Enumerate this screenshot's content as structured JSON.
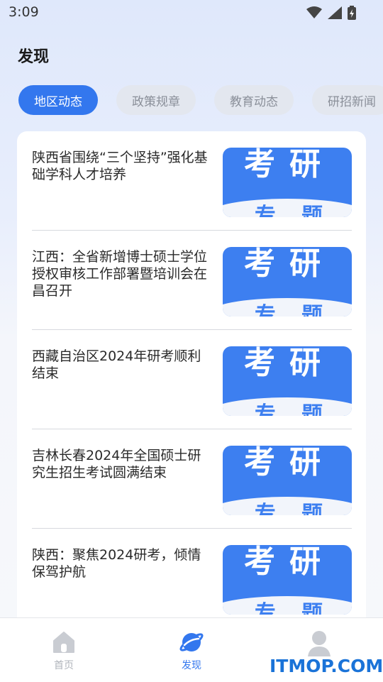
{
  "status_bar": {
    "time": "3:09"
  },
  "header": {
    "title": "发现"
  },
  "tabs": [
    {
      "label": "地区动态",
      "active": true
    },
    {
      "label": "政策规章",
      "active": false
    },
    {
      "label": "教育动态",
      "active": false
    },
    {
      "label": "研招新闻",
      "active": false
    }
  ],
  "news": [
    {
      "title": "陕西省围绕“三个坚持”强化基础学科人才培养",
      "thumb_text": "考研",
      "thumb_sub": "专题"
    },
    {
      "title": "江西：全省新增博士硕士学位授权审核工作部署暨培训会在昌召开",
      "thumb_text": "考研",
      "thumb_sub": "专题"
    },
    {
      "title": "西藏自治区2024年研考顺利结束",
      "thumb_text": "考研",
      "thumb_sub": "专题"
    },
    {
      "title": "吉林长春2024年全国硕士研究生招生考试圆满结束",
      "thumb_text": "考研",
      "thumb_sub": "专题"
    },
    {
      "title": "陕西：聚焦2024研考，倾情保驾护航",
      "thumb_text": "考研",
      "thumb_sub": "专题"
    }
  ],
  "bottom_nav": [
    {
      "label": "首页",
      "icon": "home-icon",
      "active": false
    },
    {
      "label": "发现",
      "icon": "planet-icon",
      "active": true
    },
    {
      "label": "",
      "icon": "profile-icon",
      "active": false
    }
  ],
  "watermark": "ITMOP.COM",
  "colors": {
    "accent": "#3377ee",
    "thumb_bg": "#3d7ff0",
    "tab_inactive_bg": "#e3e7ef"
  }
}
